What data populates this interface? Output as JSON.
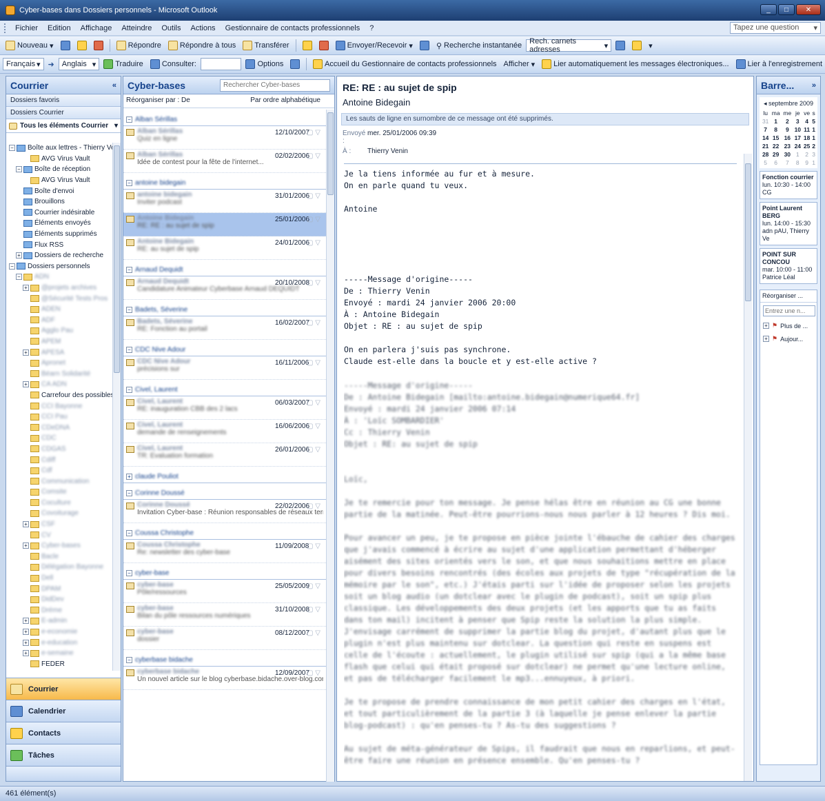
{
  "window": {
    "title": "Cyber-bases dans Dossiers personnels - Microsoft Outlook"
  },
  "menu": {
    "items": [
      "Fichier",
      "Edition",
      "Affichage",
      "Atteindre",
      "Outils",
      "Actions",
      "Gestionnaire de contacts professionnels",
      "?"
    ],
    "help_placeholder": "Tapez une question"
  },
  "toolbar1": {
    "new": "Nouveau",
    "reply": "Répondre",
    "reply_all": "Répondre à tous",
    "forward": "Transférer",
    "send_receive": "Envoyer/Recevoir",
    "instant_search": "Recherche instantanée",
    "address_search_placeholder": "Rech. carnets adresses"
  },
  "toolbar2": {
    "language_from": "Français",
    "language_to": "Anglais",
    "translate": "Traduire",
    "consult": "Consulter:",
    "options": "Options",
    "bcm_home": "Accueil du Gestionnaire de contacts professionnels",
    "display": "Afficher",
    "auto_link": "Lier automatiquement les messages électroniques...",
    "link_record": "Lier à l'enregistrement"
  },
  "nav": {
    "title": "Courrier",
    "favorites": "Dossiers favoris",
    "mail_folders": "Dossiers Courrier",
    "all_items": "Tous les éléments Courrier",
    "tree": [
      {
        "label": "Boîte aux lettres - Thierry Venin",
        "level": 0,
        "pm": "-",
        "blur": false,
        "sys": true
      },
      {
        "label": "AVG Virus Vault",
        "level": 2,
        "pm": "",
        "blur": false,
        "sys": false
      },
      {
        "label": "Boîte de réception",
        "level": 1,
        "pm": "-",
        "blur": false,
        "sys": true
      },
      {
        "label": "AVG Virus Vault",
        "level": 2,
        "pm": "",
        "blur": false,
        "sys": false
      },
      {
        "label": "Boîte d'envoi",
        "level": 1,
        "pm": "",
        "blur": false,
        "sys": true
      },
      {
        "label": "Brouillons",
        "level": 1,
        "pm": "",
        "blur": false,
        "sys": true
      },
      {
        "label": "Courrier indésirable",
        "level": 1,
        "pm": "",
        "blur": false,
        "sys": true
      },
      {
        "label": "Éléments envoyés",
        "level": 1,
        "pm": "",
        "blur": false,
        "sys": true
      },
      {
        "label": "Éléments supprimés",
        "level": 1,
        "pm": "",
        "blur": false,
        "sys": true
      },
      {
        "label": "Flux RSS",
        "level": 1,
        "pm": "",
        "blur": false,
        "sys": true
      },
      {
        "label": "Dossiers de recherche",
        "level": 1,
        "pm": "+",
        "blur": false,
        "sys": true
      },
      {
        "label": "Dossiers personnels",
        "level": 0,
        "pm": "-",
        "blur": false,
        "sys": true
      },
      {
        "label": "ADN",
        "level": 1,
        "pm": "-",
        "blur": true,
        "sys": false
      },
      {
        "label": "@projets archives",
        "level": 2,
        "pm": "+",
        "blur": true,
        "sys": false
      },
      {
        "label": "@Sécurité Tests Pros",
        "level": 2,
        "pm": "",
        "blur": true,
        "sys": false
      },
      {
        "label": "ADEN",
        "level": 2,
        "pm": "",
        "blur": true,
        "sys": false
      },
      {
        "label": "ADF",
        "level": 2,
        "pm": "",
        "blur": true,
        "sys": false
      },
      {
        "label": "Agglo Pau",
        "level": 2,
        "pm": "",
        "blur": true,
        "sys": false
      },
      {
        "label": "APEM",
        "level": 2,
        "pm": "",
        "blur": true,
        "sys": false
      },
      {
        "label": "APESA",
        "level": 2,
        "pm": "+",
        "blur": true,
        "sys": false
      },
      {
        "label": "Apronet",
        "level": 2,
        "pm": "",
        "blur": true,
        "sys": false
      },
      {
        "label": "Béarn Solidarité",
        "level": 2,
        "pm": "",
        "blur": true,
        "sys": false
      },
      {
        "label": "CA ADN",
        "level": 2,
        "pm": "+",
        "blur": true,
        "sys": false
      },
      {
        "label": "Carrefour des possibles",
        "level": 2,
        "pm": "",
        "blur": false,
        "sys": false
      },
      {
        "label": "CCI Bayonne",
        "level": 2,
        "pm": "",
        "blur": true,
        "sys": false
      },
      {
        "label": "CCI Pau",
        "level": 2,
        "pm": "",
        "blur": true,
        "sys": false
      },
      {
        "label": "CDeDNA",
        "level": 2,
        "pm": "",
        "blur": true,
        "sys": false
      },
      {
        "label": "CDC",
        "level": 2,
        "pm": "",
        "blur": true,
        "sys": false
      },
      {
        "label": "CDGAS",
        "level": 2,
        "pm": "",
        "blur": true,
        "sys": false
      },
      {
        "label": "Cdiff",
        "level": 2,
        "pm": "",
        "blur": true,
        "sys": false
      },
      {
        "label": "Cdf",
        "level": 2,
        "pm": "",
        "blur": true,
        "sys": false
      },
      {
        "label": "Communication",
        "level": 2,
        "pm": "",
        "blur": true,
        "sys": false
      },
      {
        "label": "Comsite",
        "level": 2,
        "pm": "",
        "blur": true,
        "sys": false
      },
      {
        "label": "Coculture",
        "level": 2,
        "pm": "",
        "blur": true,
        "sys": false
      },
      {
        "label": "Covoiturage",
        "level": 2,
        "pm": "",
        "blur": true,
        "sys": false
      },
      {
        "label": "CSF",
        "level": 2,
        "pm": "+",
        "blur": true,
        "sys": false
      },
      {
        "label": "CV",
        "level": 2,
        "pm": "",
        "blur": true,
        "sys": false
      },
      {
        "label": "Cyber-bases",
        "level": 2,
        "pm": "+",
        "blur": true,
        "sys": false
      },
      {
        "label": "Bacle",
        "level": 2,
        "pm": "",
        "blur": true,
        "sys": false
      },
      {
        "label": "Délégation Bayonne",
        "level": 2,
        "pm": "",
        "blur": true,
        "sys": false
      },
      {
        "label": "Dell",
        "level": 2,
        "pm": "",
        "blur": true,
        "sys": false
      },
      {
        "label": "DPAM",
        "level": 2,
        "pm": "",
        "blur": true,
        "sys": false
      },
      {
        "label": "DidDev",
        "level": 2,
        "pm": "",
        "blur": true,
        "sys": false
      },
      {
        "label": "Dréme",
        "level": 2,
        "pm": "",
        "blur": true,
        "sys": false
      },
      {
        "label": "E-admin",
        "level": 2,
        "pm": "+",
        "blur": true,
        "sys": false
      },
      {
        "label": "e-economie",
        "level": 2,
        "pm": "+",
        "blur": true,
        "sys": false
      },
      {
        "label": "e-education",
        "level": 2,
        "pm": "+",
        "blur": true,
        "sys": false
      },
      {
        "label": "e-semaine",
        "level": 2,
        "pm": "+",
        "blur": true,
        "sys": false
      },
      {
        "label": "FEDER",
        "level": 2,
        "pm": "",
        "blur": false,
        "sys": false
      }
    ],
    "buttons": [
      "Courrier",
      "Calendrier",
      "Contacts",
      "Tâches"
    ]
  },
  "list": {
    "title": "Cyber-bases",
    "search_placeholder": "Rechercher Cyber-bases",
    "arrange_by": "Réorganiser par : De",
    "order": "Par ordre alphabétique",
    "groups": [
      {
        "name": "Alban Sérillas",
        "msgs": [
          {
            "from": "Alban Sérillas",
            "date": "12/10/2007",
            "subject": "Quiz en ligne",
            "sel": false,
            "subject_blur": true
          },
          {
            "from": "Alban Sérillas",
            "date": "02/02/2006",
            "subject": "Idée de contest pour la fête de l'internet...",
            "sel": false,
            "subject_blur": false
          }
        ]
      },
      {
        "name": "antoine bidegain",
        "msgs": [
          {
            "from": "antoine bidegain",
            "date": "31/01/2006",
            "subject": "Inviter podcast",
            "sel": false,
            "subject_blur": true
          },
          {
            "from": "Antoine Bidegain",
            "date": "25/01/2006",
            "subject": "RE: RE : au sujet de spip",
            "sel": true,
            "subject_blur": true
          },
          {
            "from": "Antoine Bidegain",
            "date": "24/01/2006",
            "subject": "RE: au sujet de spip",
            "sel": false,
            "subject_blur": true
          }
        ]
      },
      {
        "name": "Arnaud Dequidt",
        "msgs": [
          {
            "from": "Arnaud Dequidt",
            "date": "20/10/2008",
            "subject": "Candidature Animateur Cyberbase Arnaud DEQUIDT",
            "sel": false,
            "subject_blur": true
          }
        ]
      },
      {
        "name": "Badets, Séverine",
        "msgs": [
          {
            "from": "Badets, Séverine",
            "date": "16/02/2007",
            "subject": "RE: Fonction au portail",
            "sel": false,
            "subject_blur": true
          }
        ]
      },
      {
        "name": "CDC Nive Adour",
        "msgs": [
          {
            "from": "CDC Nive Adour",
            "date": "16/11/2006",
            "subject": "précisions sur",
            "sel": false,
            "subject_blur": true
          }
        ]
      },
      {
        "name": "Civel, Laurent",
        "msgs": [
          {
            "from": "Civel, Laurent",
            "date": "06/03/2007",
            "subject": "RE: inauguration CBB des 2 lacs",
            "sel": false,
            "subject_blur": true
          },
          {
            "from": "Civel, Laurent",
            "date": "16/06/2006",
            "subject": "demande de renseignements",
            "sel": false,
            "subject_blur": true
          },
          {
            "from": "Civel, Laurent",
            "date": "26/01/2006",
            "subject": "TR: Evaluation formation",
            "sel": false,
            "subject_blur": true
          }
        ]
      },
      {
        "name": "claude Pouliot",
        "msgs": []
      },
      {
        "name": "Corinne Doussé",
        "msgs": [
          {
            "from": "Corinne Doussé",
            "date": "22/02/2006",
            "subject": "Invitation Cyber-base : Réunion responsables de réseaux terri...",
            "sel": false,
            "subject_blur": false
          }
        ]
      },
      {
        "name": "Coussa Christophe",
        "msgs": [
          {
            "from": "Coussa Christophe",
            "date": "11/09/2008",
            "subject": "Re: newsletter des cyber-base",
            "sel": false,
            "subject_blur": true
          }
        ]
      },
      {
        "name": "cyber-base",
        "msgs": [
          {
            "from": "cyber-base",
            "date": "25/05/2009",
            "subject": "Pôle/ressources",
            "sel": false,
            "subject_blur": true
          },
          {
            "from": "cyber-base",
            "date": "31/10/2008",
            "subject": "Bilan du pôle ressources numériques",
            "sel": false,
            "subject_blur": true
          },
          {
            "from": "cyber-base",
            "date": "08/12/2007",
            "subject": "dossier",
            "sel": false,
            "subject_blur": true
          }
        ]
      },
      {
        "name": "cyberbase bidache",
        "msgs": [
          {
            "from": "cyberbase bidache",
            "date": "12/09/2007",
            "subject": "Un nouvel article sur le blog cyberbase.bidache.over-blog.com",
            "sel": false,
            "subject_blur": false
          }
        ]
      }
    ]
  },
  "reading": {
    "subject": "RE: RE : au sujet de spip",
    "from": "Antoine Bidegain",
    "info": "Les sauts de ligne en surnombre de ce message ont été supprimés.",
    "sent_label": "Envoyé :",
    "sent": "mer. 25/01/2006 09:39",
    "to_label": "À :",
    "to": "Thierry Venin",
    "body_clear": "Je la tiens informée au fur et à mesure.\nOn en parle quand tu veux.\n\nAntoine\n\n\n\n\n\n-----Message d'origine-----\nDe : Thierry Venin\nEnvoyé : mardi 24 janvier 2006 20:00\nÀ : Antoine Bidegain\nObjet : RE : au sujet de spip\n\nOn en parlera j'suis pas synchrone.\nClaude est-elle dans la boucle et y est-elle active ?",
    "body_blurred": "-----Message d'origine-----\nDe : Antoine Bidegain [mailto:antoine.bidegain@numerique64.fr]\nEnvoyé : mardi 24 janvier 2006 07:14\nÀ : 'Loïc SOMBARDIER'\nCc : Thierry Venin\nObjet : RE: au sujet de spip\n\n\nLoïc,\n\nJe te remercie pour ton message. Je pense hélas être en réunion au CG une bonne partie de la matinée. Peut-être pourrions-nous nous parler à 12 heures ? Dis moi.\n\nPour avancer un peu, je te propose en pièce jointe l'ébauche de cahier des charges que j'avais commencé à écrire au sujet d'une application permettant d'héberger aisément des sites orientés vers le son, et que nous souhaitions mettre en place pour divers besoins rencontrés (des écoles aux projets de type \"récupération de la mémoire par le son\", etc.) J'étais parti sur l'idée de proposer selon les projets soit un blog audio (un dotclear avec le plugin de podcast), soit un spip plus classique. Les développements des deux projets (et les apports que tu as faits dans ton mail) incitent à penser que Spip reste la solution la plus simple.\nJ'envisage carrément de supprimer la partie blog du projet, d'autant plus que le plugin n'est plus maintenu sur dotclear. La question qui reste en suspens est celle de l'écoute : actuellement, le plugin utilisé sur spip (qui a la même base flash que celui qui était proposé sur dotclear) ne permet qu'une lecture online, et pas de télécharger facilement le mp3...ennuyeux, à priori.\n\nJe te propose de prendre connaissance de mon petit cahier des charges en l'état, et tout particulièrement de la partie 3 (à laquelle je pense enlever la partie blog-podcast) : qu'en penses-tu ? As-tu des suggestions ?\n\nAu sujet de méta-générateur de Spips, il faudrait que nous en reparlions, et peut-être faire une réunion en présence ensemble. Qu'en penses-tu ?"
  },
  "todo": {
    "title": "Barre...",
    "month": "septembre 2009",
    "days": [
      "lu",
      "ma",
      "me",
      "je",
      "ve",
      "s"
    ],
    "weeks": [
      [
        "31",
        "1",
        "2",
        "3",
        "4",
        "5"
      ],
      [
        "7",
        "8",
        "9",
        "10",
        "11",
        "1"
      ],
      [
        "14",
        "15",
        "16",
        "17",
        "18",
        "1"
      ],
      [
        "21",
        "22",
        "23",
        "24",
        "25",
        "2"
      ],
      [
        "28",
        "29",
        "30",
        "1",
        "2",
        "3"
      ],
      [
        "5",
        "6",
        "7",
        "8",
        "9",
        "1"
      ]
    ],
    "appointments": [
      {
        "title": "Fonction courrier",
        "time": "lun. 10:30 - 14:00",
        "place": "CG"
      },
      {
        "title": "Point Laurent BERG",
        "time": "lun. 14:00 - 15:30",
        "place": "adn pAU, Thierry Ve"
      },
      {
        "title": "POINT SUR CONCOU",
        "time": "mar. 10:00 - 11:00",
        "place": "Patrice Léal"
      }
    ],
    "arrange": "Réorganiser ...",
    "task_placeholder": "Entrez une n...",
    "tasks": [
      "Plus de ...",
      "Aujour..."
    ]
  },
  "status": {
    "count": "461 élément(s)"
  }
}
